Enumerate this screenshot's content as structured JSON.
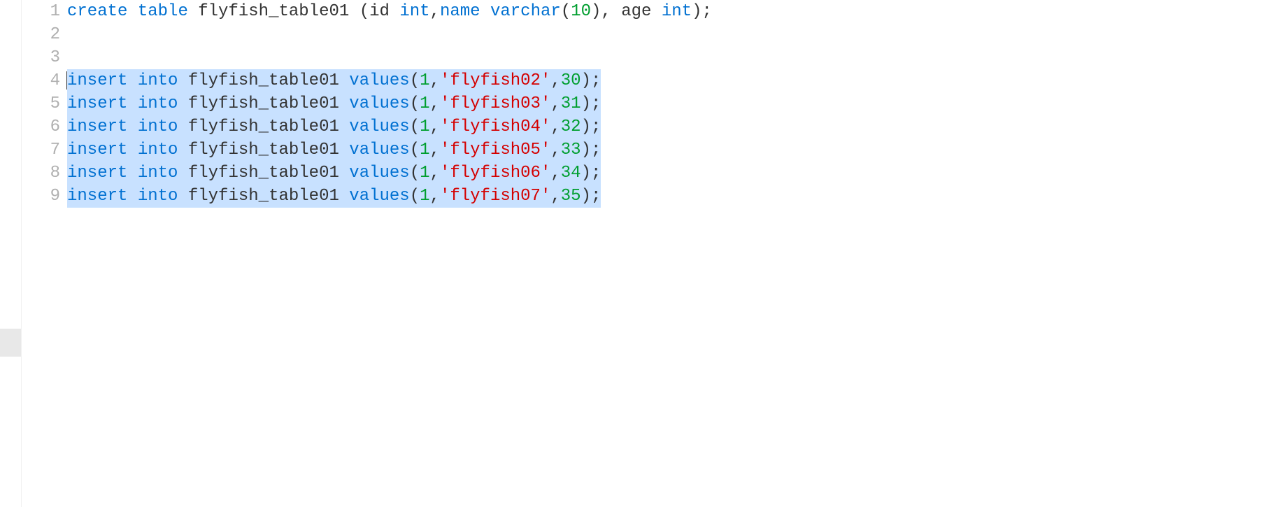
{
  "editor": {
    "lines": [
      {
        "num": "1",
        "selected": false,
        "tokens": [
          {
            "t": "kw",
            "v": "create"
          },
          {
            "t": "punct",
            "v": " "
          },
          {
            "t": "kw",
            "v": "table"
          },
          {
            "t": "punct",
            "v": " "
          },
          {
            "t": "ident",
            "v": "flyfish_table01"
          },
          {
            "t": "punct",
            "v": " ("
          },
          {
            "t": "ident",
            "v": "id"
          },
          {
            "t": "punct",
            "v": " "
          },
          {
            "t": "kw",
            "v": "int"
          },
          {
            "t": "punct",
            "v": ","
          },
          {
            "t": "kw",
            "v": "name"
          },
          {
            "t": "punct",
            "v": " "
          },
          {
            "t": "kw",
            "v": "varchar"
          },
          {
            "t": "punct",
            "v": "("
          },
          {
            "t": "num",
            "v": "10"
          },
          {
            "t": "punct",
            "v": "), "
          },
          {
            "t": "ident",
            "v": "age"
          },
          {
            "t": "punct",
            "v": " "
          },
          {
            "t": "kw",
            "v": "int"
          },
          {
            "t": "punct",
            "v": ");"
          }
        ]
      },
      {
        "num": "2",
        "selected": false,
        "tokens": []
      },
      {
        "num": "3",
        "selected": false,
        "tokens": []
      },
      {
        "num": "4",
        "selected": true,
        "cursor_start": true,
        "tokens": [
          {
            "t": "kw",
            "v": "insert"
          },
          {
            "t": "punct",
            "v": " "
          },
          {
            "t": "kw",
            "v": "into"
          },
          {
            "t": "punct",
            "v": " "
          },
          {
            "t": "ident",
            "v": "flyfish_table01"
          },
          {
            "t": "punct",
            "v": " "
          },
          {
            "t": "kw",
            "v": "values"
          },
          {
            "t": "punct",
            "v": "("
          },
          {
            "t": "num",
            "v": "1"
          },
          {
            "t": "punct",
            "v": ","
          },
          {
            "t": "str",
            "v": "'flyfish02'"
          },
          {
            "t": "punct",
            "v": ","
          },
          {
            "t": "num",
            "v": "30"
          },
          {
            "t": "punct",
            "v": ");"
          }
        ]
      },
      {
        "num": "5",
        "selected": true,
        "tokens": [
          {
            "t": "kw",
            "v": "insert"
          },
          {
            "t": "punct",
            "v": " "
          },
          {
            "t": "kw",
            "v": "into"
          },
          {
            "t": "punct",
            "v": " "
          },
          {
            "t": "ident",
            "v": "flyfish_table01"
          },
          {
            "t": "punct",
            "v": " "
          },
          {
            "t": "kw",
            "v": "values"
          },
          {
            "t": "punct",
            "v": "("
          },
          {
            "t": "num",
            "v": "1"
          },
          {
            "t": "punct",
            "v": ","
          },
          {
            "t": "str",
            "v": "'flyfish03'"
          },
          {
            "t": "punct",
            "v": ","
          },
          {
            "t": "num",
            "v": "31"
          },
          {
            "t": "punct",
            "v": ");"
          }
        ]
      },
      {
        "num": "6",
        "selected": true,
        "tokens": [
          {
            "t": "kw",
            "v": "insert"
          },
          {
            "t": "punct",
            "v": " "
          },
          {
            "t": "kw",
            "v": "into"
          },
          {
            "t": "punct",
            "v": " "
          },
          {
            "t": "ident",
            "v": "flyfish_table01"
          },
          {
            "t": "punct",
            "v": " "
          },
          {
            "t": "kw",
            "v": "values"
          },
          {
            "t": "punct",
            "v": "("
          },
          {
            "t": "num",
            "v": "1"
          },
          {
            "t": "punct",
            "v": ","
          },
          {
            "t": "str",
            "v": "'flyfish04'"
          },
          {
            "t": "punct",
            "v": ","
          },
          {
            "t": "num",
            "v": "32"
          },
          {
            "t": "punct",
            "v": ");"
          }
        ]
      },
      {
        "num": "7",
        "selected": true,
        "tokens": [
          {
            "t": "kw",
            "v": "insert"
          },
          {
            "t": "punct",
            "v": " "
          },
          {
            "t": "kw",
            "v": "into"
          },
          {
            "t": "punct",
            "v": " "
          },
          {
            "t": "ident",
            "v": "flyfish_table01"
          },
          {
            "t": "punct",
            "v": " "
          },
          {
            "t": "kw",
            "v": "values"
          },
          {
            "t": "punct",
            "v": "("
          },
          {
            "t": "num",
            "v": "1"
          },
          {
            "t": "punct",
            "v": ","
          },
          {
            "t": "str",
            "v": "'flyfish05'"
          },
          {
            "t": "punct",
            "v": ","
          },
          {
            "t": "num",
            "v": "33"
          },
          {
            "t": "punct",
            "v": ");"
          }
        ]
      },
      {
        "num": "8",
        "selected": true,
        "tokens": [
          {
            "t": "kw",
            "v": "insert"
          },
          {
            "t": "punct",
            "v": " "
          },
          {
            "t": "kw",
            "v": "into"
          },
          {
            "t": "punct",
            "v": " "
          },
          {
            "t": "ident",
            "v": "flyfish_table01"
          },
          {
            "t": "punct",
            "v": " "
          },
          {
            "t": "kw",
            "v": "values"
          },
          {
            "t": "punct",
            "v": "("
          },
          {
            "t": "num",
            "v": "1"
          },
          {
            "t": "punct",
            "v": ","
          },
          {
            "t": "str",
            "v": "'flyfish06'"
          },
          {
            "t": "punct",
            "v": ","
          },
          {
            "t": "num",
            "v": "34"
          },
          {
            "t": "punct",
            "v": ");"
          }
        ]
      },
      {
        "num": "9",
        "selected": true,
        "tokens": [
          {
            "t": "kw",
            "v": "insert"
          },
          {
            "t": "punct",
            "v": " "
          },
          {
            "t": "kw",
            "v": "into"
          },
          {
            "t": "punct",
            "v": " "
          },
          {
            "t": "ident",
            "v": "flyfish_table01"
          },
          {
            "t": "punct",
            "v": " "
          },
          {
            "t": "kw",
            "v": "values"
          },
          {
            "t": "punct",
            "v": "("
          },
          {
            "t": "num",
            "v": "1"
          },
          {
            "t": "punct",
            "v": ","
          },
          {
            "t": "str",
            "v": "'flyfish07'"
          },
          {
            "t": "punct",
            "v": ","
          },
          {
            "t": "num",
            "v": "35"
          },
          {
            "t": "punct",
            "v": ");"
          }
        ]
      }
    ],
    "selection_bg": "#c8e1ff",
    "colors": {
      "keyword": "#0070d1",
      "identifier": "#333333",
      "string": "#d40000",
      "number": "#009e2f",
      "punct": "#333333"
    }
  }
}
